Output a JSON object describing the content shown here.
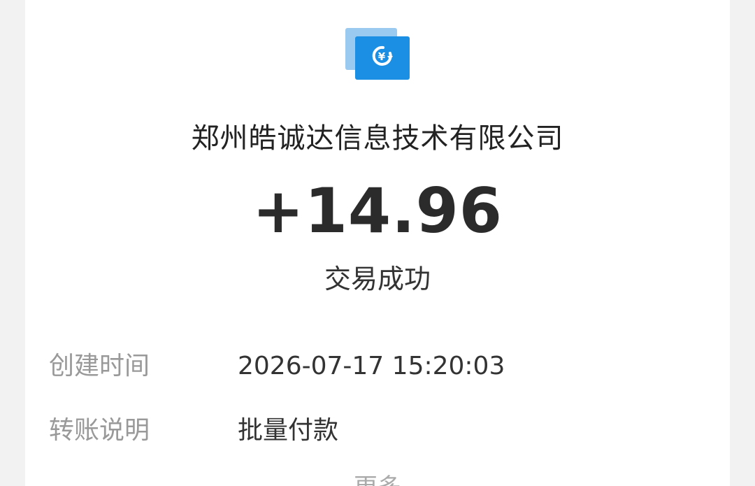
{
  "transaction": {
    "icon": "refund-yuan-icon",
    "payer_name": "郑州皓诚达信息技术有限公司",
    "amount": "+14.96",
    "status": "交易成功"
  },
  "details": [
    {
      "label": "创建时间",
      "value": "2026-07-17 15:20:03"
    },
    {
      "label": "转账说明",
      "value": "批量付款"
    }
  ],
  "more_label": "更多",
  "colors": {
    "page_background": "#f2f2f2",
    "card_background": "#ffffff",
    "icon_blue": "#1a8fe3",
    "icon_light_blue": "#9bcaf1",
    "label_gray": "#999999",
    "text_dark": "#333333"
  }
}
